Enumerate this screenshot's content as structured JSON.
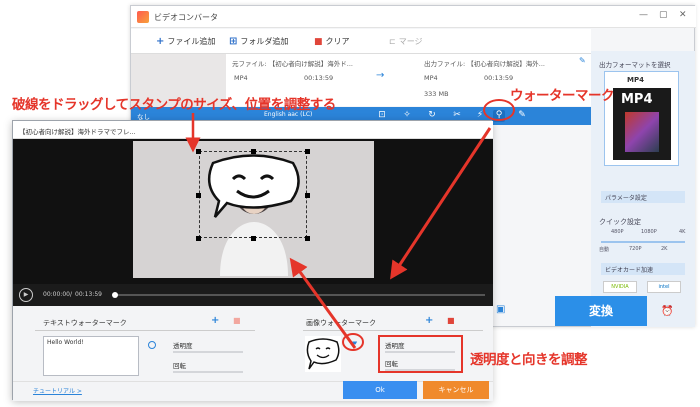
{
  "main_window": {
    "title": "ビデオコンバータ",
    "toolbar": {
      "add_file": "ファイル追加",
      "add_folder": "フォルダ追加",
      "clear": "クリア",
      "merge": "マージ"
    },
    "source_file_label": "元ファイル: 【初心者向け解説】海外ド...",
    "output_file_label": "出力ファイル: 【初心者向け解説】海外...",
    "src_format": "MP4",
    "src_duration": "00:13:59",
    "out_format": "MP4",
    "out_duration": "00:13:59",
    "out_size": "333 MB",
    "subtitle_select": "なし",
    "audio_select": "English aac (LC)",
    "right_panel": {
      "choose_format": "出力フォーマットを選択",
      "format_name": "MP4",
      "param_settings": "パラメータ設定",
      "quick_settings": "クイック設定",
      "quality_ticks": [
        "480P",
        "1080P",
        "4K"
      ],
      "quality_ticks2": [
        "自動",
        "720P",
        "2K"
      ],
      "gpu_accel": "ビデオカード加速",
      "nvidia": "NVIDIA",
      "intel": "intel"
    },
    "convert_label": "変換"
  },
  "dialog": {
    "title": "【初心者向け解説】海外ドラマでフレ...",
    "time_current": "00:00:00",
    "time_total": "00:13:59",
    "text_watermark_label": "テキストウォーターマーク",
    "text_value": "Hello World!",
    "opacity_label": "透明度",
    "rotation_label": "回転",
    "image_watermark_label": "画像ウォーターマーク",
    "img_opacity_label": "透明度",
    "img_rotation_label": "回転",
    "tutorial_link": "チュートリアル >",
    "ok_label": "Ok",
    "cancel_label": "キャンセル"
  },
  "annotations": {
    "drag_note": "破線をドラッグしてスタンプのサイズ、位置を調整する",
    "watermark_note": "ウォーターマーク",
    "opacity_note": "透明度と向きを調整"
  },
  "colors": {
    "accent": "#2b84d9",
    "annotation": "#e5352a",
    "convert": "#2b8fe8",
    "cancel": "#f08a2c"
  }
}
